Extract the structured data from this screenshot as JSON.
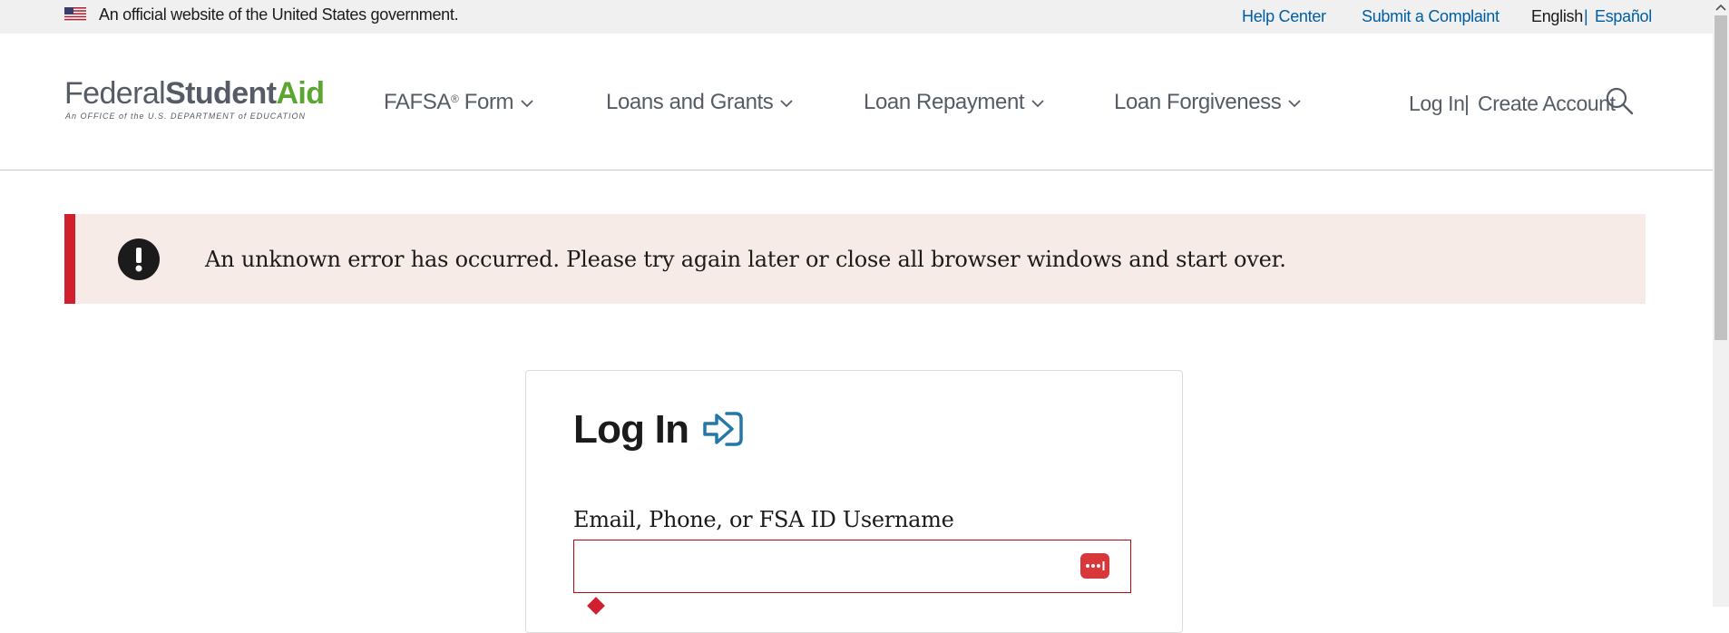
{
  "gov_banner": {
    "text": "An official website of the United States government.",
    "help_center": "Help Center",
    "submit_complaint": "Submit a Complaint",
    "lang_english": "English",
    "lang_separator": "|",
    "lang_spanish": "Español"
  },
  "logo": {
    "federal": "Federal",
    "student": "Student",
    "aid": "Aid",
    "subtitle": "An OFFICE of the U.S. DEPARTMENT of EDUCATION"
  },
  "nav": {
    "fafsa": "FAFSA",
    "fafsa_mark": "®",
    "fafsa_suffix": " Form",
    "loans_grants": "Loans and Grants",
    "loan_repayment": "Loan Repayment",
    "loan_forgiveness": "Loan Forgiveness"
  },
  "account": {
    "log_in": "Log In",
    "separator": "|",
    "create_account": "Create Account"
  },
  "alert": {
    "message": "An unknown error has occurred. Please try again later or close all browser windows and start over."
  },
  "login_card": {
    "title": "Log In",
    "username_label": "Email, Phone, or FSA ID Username",
    "username_value": ""
  },
  "colors": {
    "link_blue": "#005ea2",
    "brand_green": "#5aa630",
    "error_red": "#d0202e",
    "alert_bg": "#f6ebe6"
  },
  "icons": [
    "us-flag-icon",
    "chevron-down-icon",
    "search-icon",
    "alert-exclamation-icon",
    "login-arrow-icon",
    "password-manager-icon"
  ]
}
